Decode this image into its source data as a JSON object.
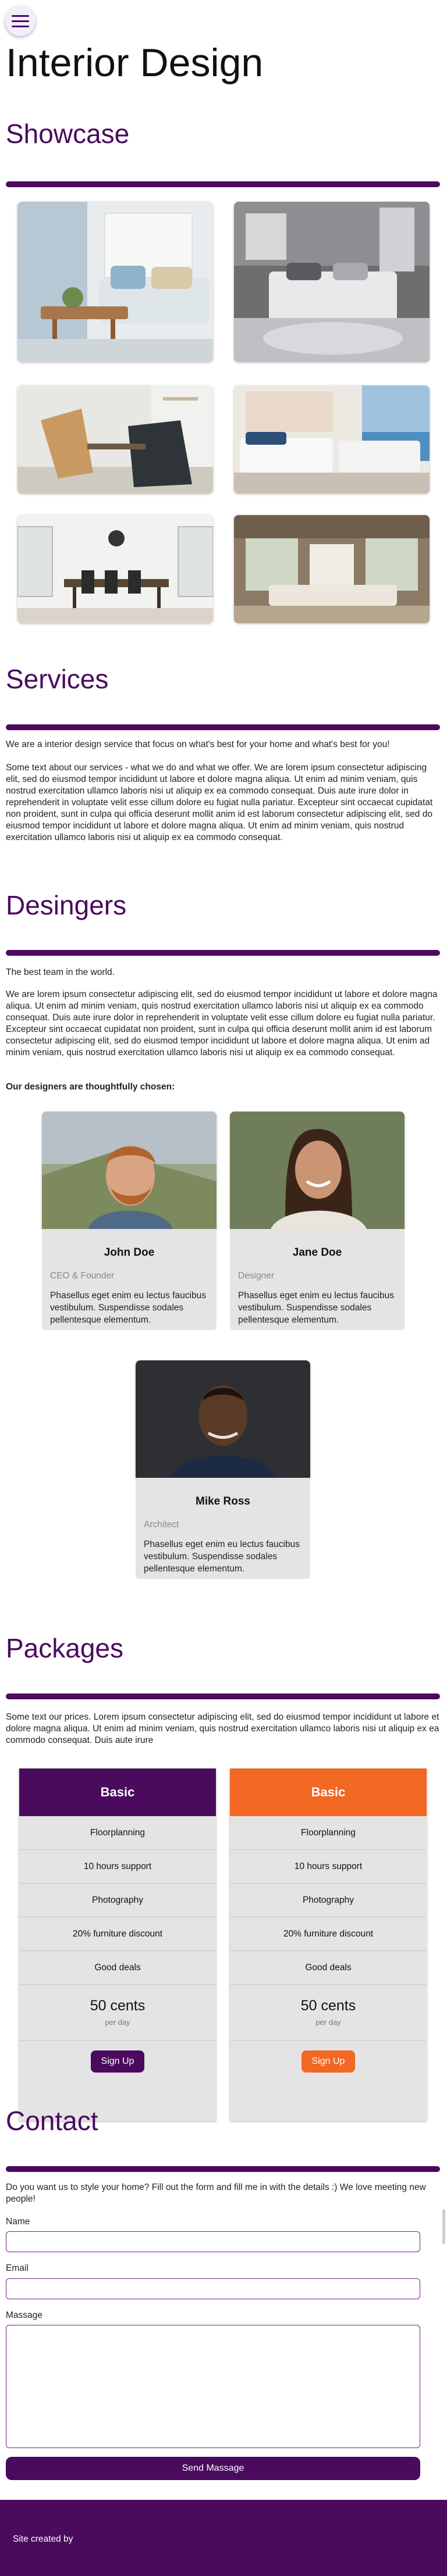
{
  "menu": {
    "icon": "hamburger-menu-icon"
  },
  "page_title": "Interior Design",
  "showcase": {
    "heading": "Showcase",
    "images": [
      "living-room-photo",
      "bedroom-photo",
      "dining-chairs-photo",
      "ocean-view-bedroom-photo",
      "dining-room-photo",
      "open-plan-living-photo"
    ]
  },
  "services": {
    "heading": "Services",
    "intro": "We are a interior design service that focus on what's best for your home and what's best for you!",
    "body": "Some text about our services - what we do and what we offer. We are lorem ipsum consectetur adipiscing elit, sed do eiusmod tempor incididunt ut labore et dolore magna aliqua. Ut enim ad minim veniam, quis nostrud exercitation ullamco laboris nisi ut aliquip ex ea commodo consequat. Duis aute irure dolor in reprehenderit in voluptate velit esse cillum dolore eu fugiat nulla pariatur. Excepteur sint occaecat cupidatat non proident, sunt in culpa qui officia deserunt mollit anim id est laborum consectetur adipiscing elit, sed do eiusmod tempor incididunt ut labore et dolore magna aliqua. Ut enim ad minim veniam, quis nostrud exercitation ullamco laboris nisi ut aliquip ex ea commodo consequat."
  },
  "designers": {
    "heading": "Desingers",
    "tagline": "The best team in the world.",
    "body": "We are lorem ipsum consectetur adipiscing elit, sed do eiusmod tempor incididunt ut labore et dolore magna aliqua. Ut enim ad minim veniam, quis nostrud exercitation ullamco laboris nisi ut aliquip ex ea commodo consequat. Duis aute irure dolor in reprehenderit in voluptate velit esse cillum dolore eu fugiat nulla pariatur. Excepteur sint occaecat cupidatat non proident, sunt in culpa qui officia deserunt mollit anim id est laborum consectetur adipiscing elit, sed do eiusmod tempor incididunt ut labore et dolore magna aliqua. Ut enim ad minim veniam, quis nostrud exercitation ullamco laboris nisi ut aliquip ex ea commodo consequat.",
    "chosen_label": "Our designers are thoughtfully chosen:",
    "people": [
      {
        "name": "John Doe",
        "role": "CEO & Founder",
        "desc": "Phasellus eget enim eu lectus faucibus vestibulum. Suspendisse sodales pellentesque elementum."
      },
      {
        "name": "Jane Doe",
        "role": "Designer",
        "desc": "Phasellus eget enim eu lectus faucibus vestibulum. Suspendisse sodales pellentesque elementum."
      },
      {
        "name": "Mike Ross",
        "role": "Architect",
        "desc": "Phasellus eget enim eu lectus faucibus vestibulum. Suspendisse sodales pellentesque elementum."
      }
    ]
  },
  "packages": {
    "heading": "Packages",
    "intro": "Some text our prices. Lorem ipsum consectetur adipiscing elit, sed do eiusmod tempor incididunt ut labore et dolore magna aliqua. Ut enim ad minim veniam, quis nostrud exercitation ullamco laboris nisi ut aliquip ex ea commodo consequat. Duis aute irure",
    "plans": [
      {
        "title": "Basic",
        "color": "#4a0a5e",
        "features": [
          "Floorplanning",
          "10 hours support",
          "Photography",
          "20% furniture discount",
          "Good deals"
        ],
        "price": "50 cents",
        "per": "per day",
        "button": "Sign Up"
      },
      {
        "title": "Basic",
        "color": "#f26722",
        "features": [
          "Floorplanning",
          "10 hours support",
          "Photography",
          "20% furniture discount",
          "Good deals"
        ],
        "price": "50 cents",
        "per": "per day",
        "button": "Sign Up"
      }
    ]
  },
  "contact": {
    "heading": "Contact",
    "intro": "Do you want us to style your home? Fill out the form and fill me in with the details :) We love meeting new people!",
    "name_label": "Name",
    "email_label": "Email",
    "message_label": "Massage",
    "send_label": "Send Massage"
  },
  "footer": {
    "text": "Site created by"
  },
  "colors": {
    "brand": "#4a0a5e",
    "accent": "#f26722",
    "card_bg": "#e4e4e4"
  }
}
